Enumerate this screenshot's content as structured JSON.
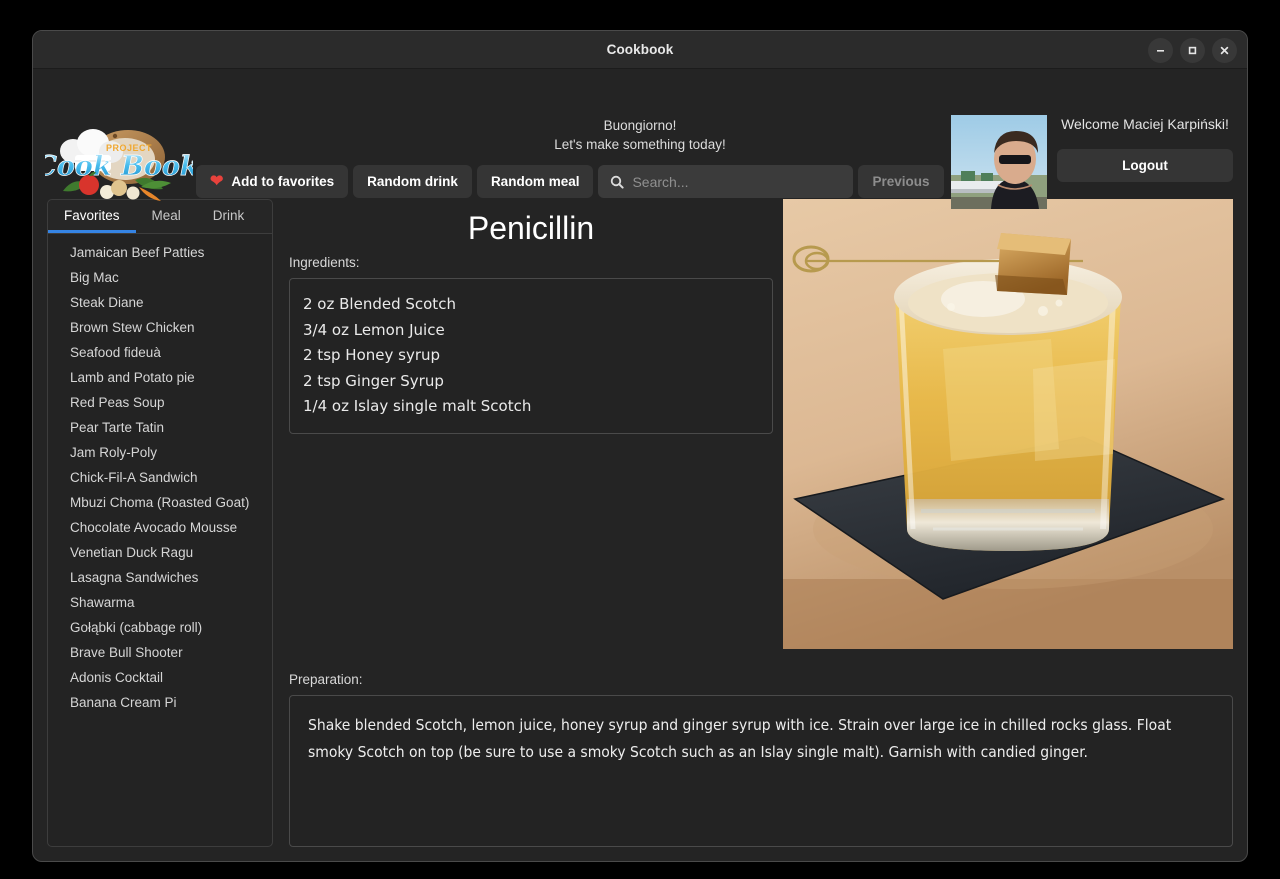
{
  "window": {
    "title": "Cookbook",
    "controls": [
      {
        "name": "minimize",
        "glyph": "minimize-icon"
      },
      {
        "name": "maximize",
        "glyph": "maximize-icon"
      },
      {
        "name": "close",
        "glyph": "close-icon"
      }
    ]
  },
  "brand": {
    "logo_alt": "Project Cook Book",
    "logo_top_word": "PROJECT",
    "logo_script_word": "Cook Book",
    "logo_script_color": "#4ec3f0",
    "logo_top_word_color": "#f0a830"
  },
  "greeting": {
    "line1": "Buongiorno!",
    "line2": "Let's make something today!"
  },
  "toolbar": {
    "add_to_favorites_label": "Add to favorites",
    "random_drink_label": "Random drink",
    "random_meal_label": "Random meal",
    "previous_label": "Previous",
    "previous_disabled": true,
    "heart_color": "#e8423c"
  },
  "search": {
    "placeholder": "Search...",
    "value": ""
  },
  "user": {
    "welcome_text": "Welcome Maciej Karpiński!",
    "logout_label": "Logout",
    "avatar_alt": "Man wearing sunglasses outdoors"
  },
  "sidebar": {
    "tabs": [
      {
        "label": "Favorites",
        "active": true
      },
      {
        "label": "Meal",
        "active": false
      },
      {
        "label": "Drink",
        "active": false
      }
    ],
    "active_tab_color": "#3584e4",
    "items": [
      "Jamaican Beef Patties",
      "Big Mac",
      "Steak Diane",
      "Brown Stew Chicken",
      "Seafood fideuà",
      "Lamb and Potato pie",
      "Red Peas Soup",
      "Pear Tarte Tatin",
      "Jam Roly-Poly",
      "Chick-Fil-A Sandwich",
      "Mbuzi Choma (Roasted Goat)",
      "Chocolate Avocado Mousse",
      "Venetian Duck Ragu",
      "Lasagna Sandwiches",
      "Shawarma",
      "Gołąbki (cabbage roll)",
      "Brave Bull Shooter",
      "Adonis Cocktail",
      "Banana Cream Pi"
    ]
  },
  "recipe": {
    "title": "Penicillin",
    "ingredients_label": "Ingredients:",
    "ingredients": [
      "2 oz Blended Scotch",
      "3/4 oz Lemon Juice",
      "2 tsp Honey syrup",
      "2 tsp Ginger Syrup",
      "1/4 oz Islay single malt Scotch"
    ],
    "preparation_label": "Preparation:",
    "preparation": "Shake blended Scotch, lemon juice, honey syrup and ginger syrup with ice. Strain over large ice in chilled rocks glass. Float smoky Scotch on top (be sure to use a smoky Scotch such as an Islay single malt). Garnish with candied ginger.",
    "image_alt": "Penicillin cocktail in a rocks glass with candied ginger on a pick, on a slate coaster"
  },
  "theme": {
    "window_bg": "#242424",
    "titlebar_bg": "#2b2b2b",
    "panel_bg": "#232323",
    "border": "#4a4a4a",
    "text": "#e8e8e8",
    "accent": "#3584e4"
  }
}
